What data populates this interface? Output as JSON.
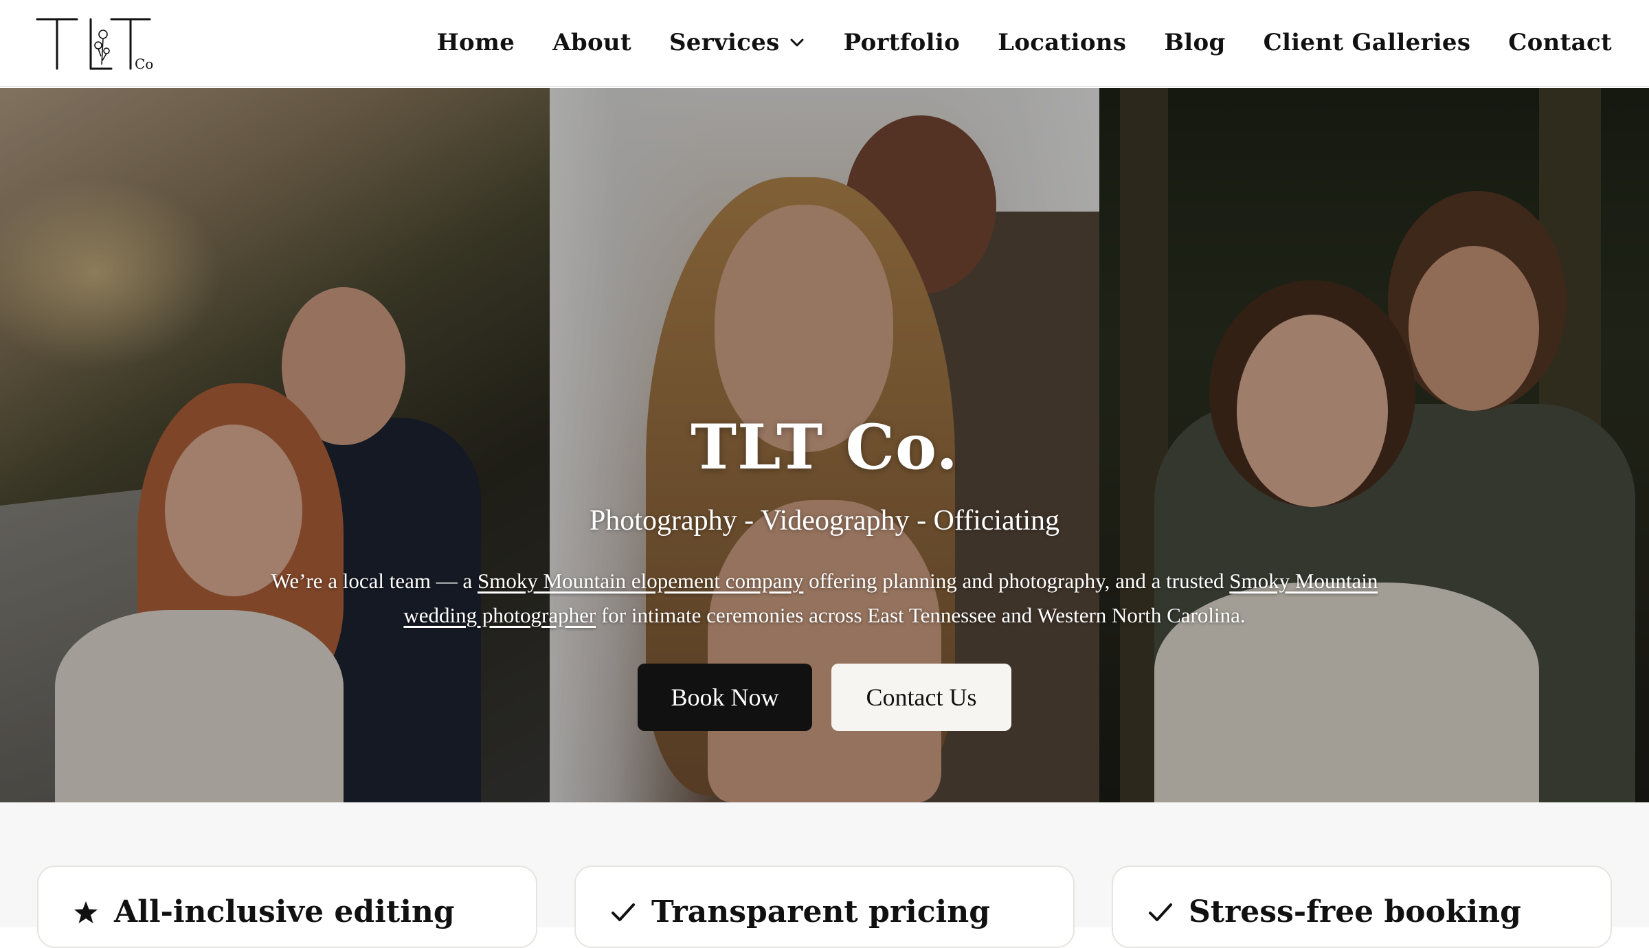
{
  "header": {
    "logo_text": "TLT Co.",
    "nav": [
      {
        "label": "Home"
      },
      {
        "label": "About"
      },
      {
        "label": "Services",
        "icon": "chevron-down-icon"
      },
      {
        "label": "Portfolio"
      },
      {
        "label": "Locations"
      },
      {
        "label": "Blog"
      },
      {
        "label": "Client Galleries"
      },
      {
        "label": "Contact"
      }
    ]
  },
  "hero": {
    "title": "TLT Co.",
    "subtitle": "Photography - Videography - Officiating",
    "desc_part1": "We’re a local team — a ",
    "link1": "Smoky Mountain elopement company",
    "desc_part2": " offering planning and photography, and a trusted ",
    "link2": "Smoky Mountain wedding photographer",
    "desc_part3": " for intimate ceremonies across East Tennessee and Western North Carolina.",
    "book_label": "Book Now",
    "contact_label": "Contact Us"
  },
  "features": [
    {
      "title": "All-inclusive editing",
      "icon": "star-icon"
    },
    {
      "title": "Transparent pricing",
      "icon": "check-icon"
    },
    {
      "title": "Stress-free booking",
      "icon": "check-icon"
    }
  ],
  "colors": {
    "nav_text": "#111111",
    "button_dark": "#111111",
    "button_light": "#f7f5f2",
    "section_bg": "#f7f7f7"
  }
}
